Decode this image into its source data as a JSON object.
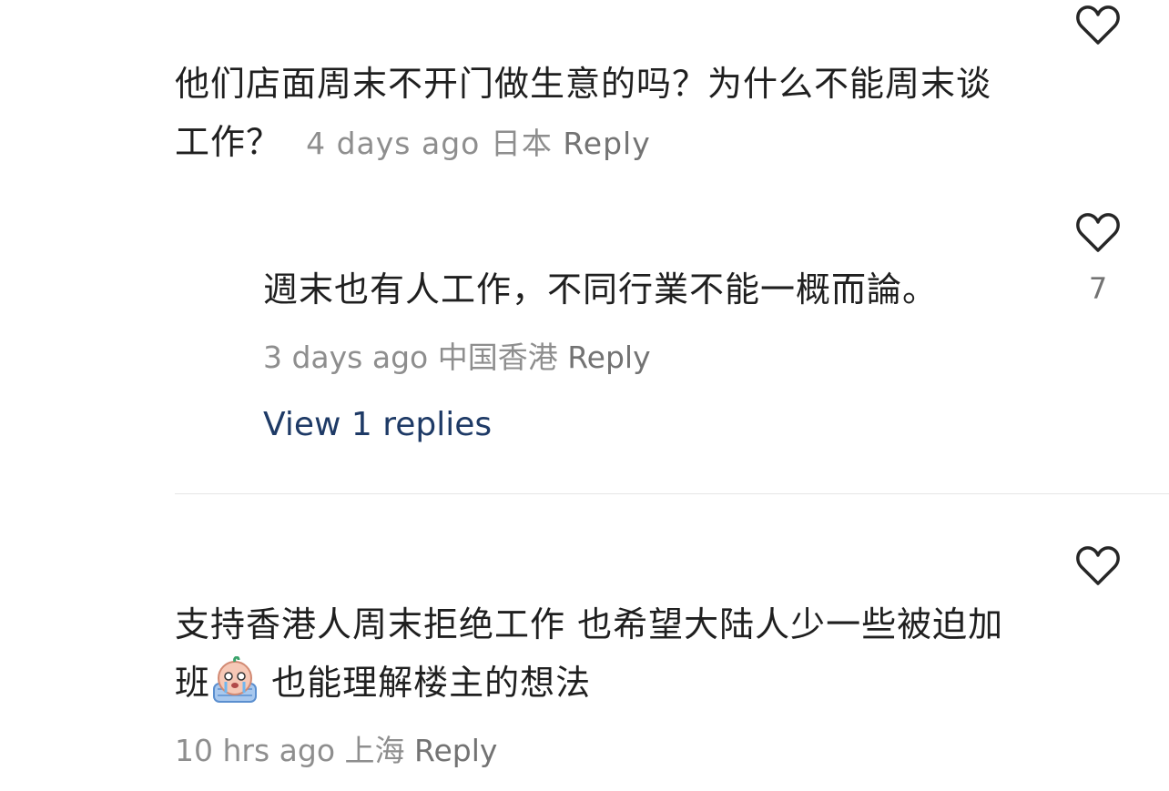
{
  "comments": [
    {
      "text": "他们店面周末不开门做生意的吗？为什么不能周末谈工作？",
      "time": "4 days ago",
      "location": "日本",
      "reply_label": "Reply",
      "like_icon": "heart-outline-icon"
    },
    {
      "text": "週末也有人工作，不同行業不能一概而論。",
      "time": "3 days ago",
      "location": "中国香港",
      "reply_label": "Reply",
      "like_icon": "heart-outline-icon",
      "like_count": "7",
      "view_replies": "View 1 replies"
    },
    {
      "text_before_emoji": "支持香港人周末拒绝工作 也希望大陆人少一些被迫加班",
      "emoji": "crying-baby-emoji",
      "text_after_emoji": " 也能理解楼主的想法",
      "time": "10 hrs ago",
      "location": "上海",
      "reply_label": "Reply",
      "like_icon": "heart-outline-icon"
    }
  ]
}
